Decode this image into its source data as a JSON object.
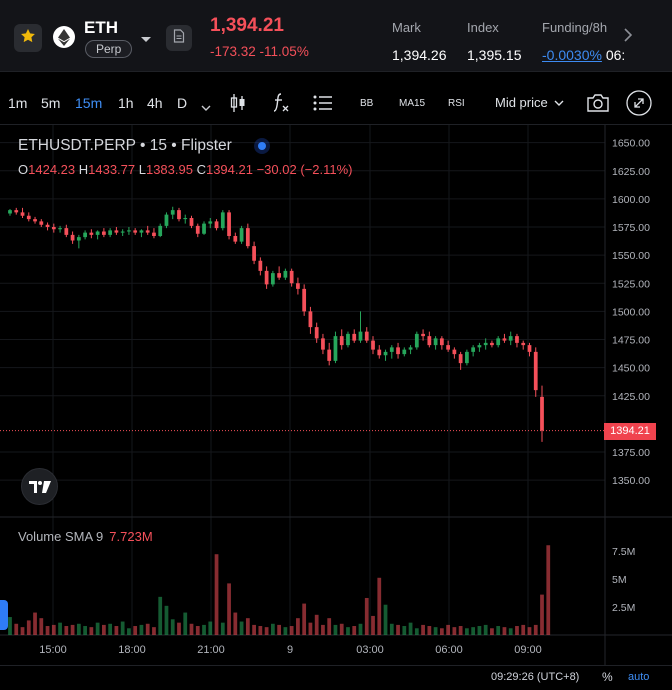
{
  "header": {
    "symbol": "ETH",
    "contract_type": "Perp",
    "last_price": "1,394.21",
    "change": "-173.32 -11.05%",
    "stats": [
      {
        "label": "Mark",
        "value": "1,394.26"
      },
      {
        "label": "Index",
        "value": "1,395.15"
      },
      {
        "label": "Funding/8h",
        "value": "-0.0030%",
        "extra": "06:"
      }
    ],
    "icons": {
      "favorite": "star-icon",
      "coin": "ethereum-icon",
      "menu": "chevron-down-icon",
      "info": "document-icon",
      "more": "chevron-right-icon"
    },
    "colors": {
      "down": "#f5505a",
      "up": "#26a65b",
      "accent": "#2f7cf6",
      "favorite": "#f0b90b"
    }
  },
  "toolbar": {
    "intervals": [
      "1m",
      "5m",
      "15m",
      "1h",
      "4h",
      "D"
    ],
    "active_interval": "15m",
    "indicators": [
      "BB",
      "MA15",
      "RSI"
    ],
    "price_mode": "Mid price",
    "icons": [
      "chevron-down-icon",
      "candlestick-icon",
      "function-icon",
      "list-icon",
      "camera-icon",
      "expand-icon"
    ]
  },
  "chart": {
    "title": "ETHUSDT.PERP • 15 • Flipster",
    "ohlc": {
      "o": "1424.23",
      "h": "1433.77",
      "l": "1383.95",
      "c": "1394.21",
      "chg": "−30.02 (−2.11%)"
    },
    "current_price_label": "1394.21",
    "volume_label": "Volume SMA 9",
    "volume_value": "7.723M",
    "price_axis": [
      "1650.00",
      "1625.00",
      "1600.00",
      "1575.00",
      "1550.00",
      "1525.00",
      "1500.00",
      "1475.00",
      "1450.00",
      "1425.00",
      "1375.00",
      "1350.00"
    ],
    "volume_axis": [
      "7.5M",
      "5M",
      "2.5M"
    ],
    "time_axis": [
      "15:00",
      "18:00",
      "21:00",
      "9",
      "03:00",
      "06:00",
      "09:00"
    ]
  },
  "chart_data": {
    "type": "candlestick",
    "title": "ETHUSDT.PERP • 15 • Flipster",
    "ylim": [
      1335,
      1655
    ],
    "volume_ylim": [
      0,
      8.2
    ],
    "ohlc_candles": [
      [
        1587,
        1591,
        1585,
        1590
      ],
      [
        1590,
        1592,
        1586,
        1588
      ],
      [
        1588,
        1592,
        1583,
        1585
      ],
      [
        1585,
        1588,
        1580,
        1582
      ],
      [
        1582,
        1584,
        1578,
        1580
      ],
      [
        1580,
        1582,
        1575,
        1577
      ],
      [
        1577,
        1579,
        1572,
        1575
      ],
      [
        1575,
        1578,
        1570,
        1573
      ],
      [
        1573,
        1576,
        1570,
        1574
      ],
      [
        1574,
        1577,
        1566,
        1568
      ],
      [
        1568,
        1571,
        1560,
        1563
      ],
      [
        1563,
        1568,
        1556,
        1566
      ],
      [
        1566,
        1572,
        1564,
        1570
      ],
      [
        1570,
        1573,
        1565,
        1568
      ],
      [
        1568,
        1572,
        1564,
        1571
      ],
      [
        1571,
        1574,
        1566,
        1568
      ],
      [
        1568,
        1574,
        1566,
        1572
      ],
      [
        1572,
        1575,
        1568,
        1570
      ],
      [
        1570,
        1573,
        1567,
        1571
      ],
      [
        1571,
        1575,
        1568,
        1572
      ],
      [
        1572,
        1574,
        1568,
        1570
      ],
      [
        1570,
        1573,
        1566,
        1572
      ],
      [
        1572,
        1576,
        1568,
        1570
      ],
      [
        1570,
        1574,
        1565,
        1567
      ],
      [
        1567,
        1578,
        1566,
        1576
      ],
      [
        1576,
        1588,
        1574,
        1586
      ],
      [
        1586,
        1593,
        1582,
        1590
      ],
      [
        1590,
        1592,
        1580,
        1582
      ],
      [
        1582,
        1586,
        1578,
        1583
      ],
      [
        1583,
        1585,
        1574,
        1576
      ],
      [
        1576,
        1578,
        1566,
        1569
      ],
      [
        1569,
        1580,
        1568,
        1578
      ],
      [
        1578,
        1583,
        1574,
        1580
      ],
      [
        1580,
        1582,
        1572,
        1574
      ],
      [
        1574,
        1590,
        1572,
        1588
      ],
      [
        1588,
        1590,
        1564,
        1567
      ],
      [
        1567,
        1570,
        1560,
        1562
      ],
      [
        1562,
        1576,
        1560,
        1574
      ],
      [
        1574,
        1578,
        1556,
        1558
      ],
      [
        1558,
        1562,
        1542,
        1545
      ],
      [
        1545,
        1548,
        1532,
        1536
      ],
      [
        1536,
        1540,
        1520,
        1524
      ],
      [
        1524,
        1536,
        1522,
        1534
      ],
      [
        1534,
        1540,
        1528,
        1530
      ],
      [
        1530,
        1538,
        1528,
        1536
      ],
      [
        1536,
        1538,
        1522,
        1525
      ],
      [
        1525,
        1530,
        1515,
        1520
      ],
      [
        1520,
        1524,
        1496,
        1500
      ],
      [
        1500,
        1504,
        1480,
        1486
      ],
      [
        1486,
        1490,
        1472,
        1476
      ],
      [
        1476,
        1480,
        1462,
        1466
      ],
      [
        1466,
        1472,
        1452,
        1456
      ],
      [
        1456,
        1482,
        1454,
        1478
      ],
      [
        1478,
        1484,
        1466,
        1470
      ],
      [
        1470,
        1482,
        1468,
        1480
      ],
      [
        1480,
        1484,
        1472,
        1474
      ],
      [
        1474,
        1500,
        1472,
        1482
      ],
      [
        1482,
        1486,
        1472,
        1474
      ],
      [
        1474,
        1478,
        1462,
        1466
      ],
      [
        1466,
        1470,
        1458,
        1461
      ],
      [
        1461,
        1466,
        1456,
        1464
      ],
      [
        1464,
        1470,
        1458,
        1468
      ],
      [
        1468,
        1472,
        1458,
        1462
      ],
      [
        1462,
        1468,
        1460,
        1466
      ],
      [
        1466,
        1470,
        1462,
        1468
      ],
      [
        1468,
        1482,
        1466,
        1480
      ],
      [
        1480,
        1484,
        1474,
        1478
      ],
      [
        1478,
        1482,
        1468,
        1470
      ],
      [
        1470,
        1478,
        1466,
        1476
      ],
      [
        1476,
        1478,
        1466,
        1470
      ],
      [
        1470,
        1474,
        1464,
        1466
      ],
      [
        1466,
        1468,
        1458,
        1462
      ],
      [
        1462,
        1464,
        1448,
        1454
      ],
      [
        1454,
        1466,
        1452,
        1464
      ],
      [
        1464,
        1470,
        1460,
        1468
      ],
      [
        1468,
        1472,
        1464,
        1470
      ],
      [
        1470,
        1476,
        1466,
        1472
      ],
      [
        1472,
        1474,
        1468,
        1470
      ],
      [
        1470,
        1478,
        1468,
        1476
      ],
      [
        1476,
        1480,
        1472,
        1474
      ],
      [
        1474,
        1482,
        1470,
        1478
      ],
      [
        1478,
        1480,
        1468,
        1472
      ],
      [
        1472,
        1474,
        1466,
        1470
      ],
      [
        1470,
        1472,
        1460,
        1464
      ],
      [
        1464,
        1468,
        1424,
        1430
      ],
      [
        1424,
        1434,
        1384,
        1394
      ]
    ],
    "volume_millions": [
      1.6,
      1.0,
      0.7,
      1.3,
      2.0,
      1.5,
      0.8,
      0.9,
      1.1,
      0.8,
      0.9,
      1.0,
      0.8,
      0.7,
      1.1,
      0.9,
      1.0,
      0.8,
      1.2,
      0.6,
      0.8,
      0.9,
      1.0,
      0.7,
      3.4,
      2.6,
      1.4,
      1.1,
      2.0,
      1.0,
      0.8,
      0.9,
      1.2,
      7.2,
      1.1,
      4.6,
      2.0,
      1.2,
      1.5,
      0.9,
      0.8,
      0.7,
      1.0,
      0.9,
      0.7,
      0.8,
      1.5,
      2.8,
      1.1,
      1.8,
      0.9,
      1.5,
      0.9,
      1.0,
      0.7,
      0.8,
      1.0,
      3.3,
      1.7,
      5.1,
      2.7,
      1.0,
      0.9,
      0.8,
      1.1,
      0.6,
      0.9,
      0.8,
      0.7,
      0.6,
      0.9,
      0.7,
      0.8,
      0.6,
      0.7,
      0.8,
      0.9,
      0.6,
      0.8,
      0.7,
      0.6,
      0.8,
      0.9,
      0.7,
      0.9,
      3.6,
      8.0
    ]
  },
  "footer": {
    "time": "09:29:26 (UTC+8)",
    "percent": "%",
    "auto": "auto"
  }
}
